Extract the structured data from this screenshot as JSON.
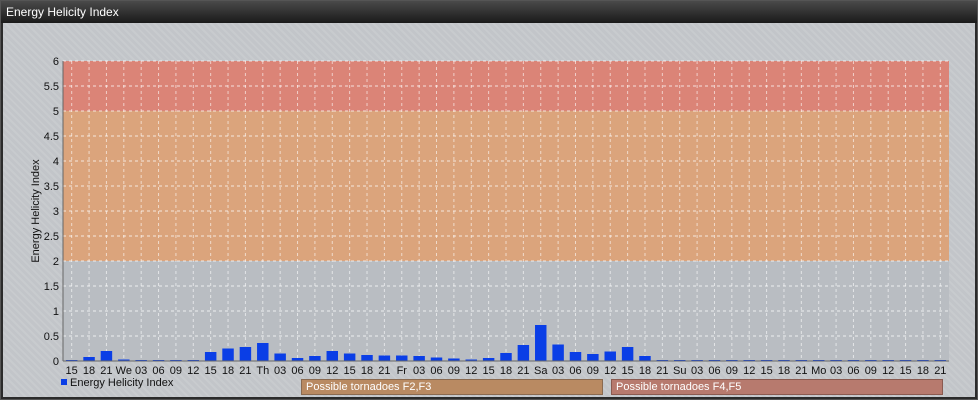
{
  "window": {
    "title": "Energy Helicity Index"
  },
  "legend": {
    "series_label": "Energy Helicity Index",
    "swatch_color": "#0a3ee6"
  },
  "zones": [
    {
      "label": "Possible tornadoes F2,F3",
      "color": "#e0a070"
    },
    {
      "label": "Possible tornadoes F4,F5",
      "color": "#e07a6a"
    }
  ],
  "chart_data": {
    "type": "bar",
    "title": "",
    "xlabel": "",
    "ylabel": "Energy Helicity Index",
    "ylim": [
      0,
      6
    ],
    "yticks": [
      "0",
      "0.5",
      "1",
      "1.5",
      "2",
      "2.5",
      "3",
      "3.5",
      "4",
      "4.5",
      "5",
      "5.5",
      "6"
    ],
    "bands": [
      {
        "from": 2,
        "to": 5,
        "color": "#e0a070"
      },
      {
        "from": 5,
        "to": 6,
        "color": "#e07a6a"
      }
    ],
    "grid": true,
    "categories": [
      "15",
      "18",
      "21",
      "We",
      "03",
      "06",
      "09",
      "12",
      "15",
      "18",
      "21",
      "Th",
      "03",
      "06",
      "09",
      "12",
      "15",
      "18",
      "21",
      "Fr",
      "03",
      "06",
      "09",
      "12",
      "15",
      "18",
      "21",
      "Sa",
      "03",
      "06",
      "09",
      "12",
      "15",
      "18",
      "21",
      "Su",
      "03",
      "06",
      "09",
      "12",
      "15",
      "18",
      "21",
      "Mo",
      "03",
      "06",
      "09",
      "12",
      "15",
      "18",
      "21"
    ],
    "values": [
      0.02,
      0.08,
      0.2,
      0.03,
      0.02,
      0.02,
      0.02,
      0.02,
      0.18,
      0.25,
      0.28,
      0.36,
      0.15,
      0.06,
      0.1,
      0.2,
      0.15,
      0.12,
      0.11,
      0.11,
      0.1,
      0.07,
      0.05,
      0.03,
      0.06,
      0.16,
      0.32,
      0.72,
      0.33,
      0.18,
      0.14,
      0.19,
      0.28,
      0.1,
      0.02,
      0.02,
      0.02,
      0.02,
      0.02,
      0.02,
      0.02,
      0.02,
      0.02,
      0.02,
      0.02,
      0.02,
      0.02,
      0.02,
      0.02,
      0.02,
      0.02
    ],
    "series": [
      {
        "name": "Energy Helicity Index",
        "color": "#0a3ee6"
      }
    ]
  }
}
